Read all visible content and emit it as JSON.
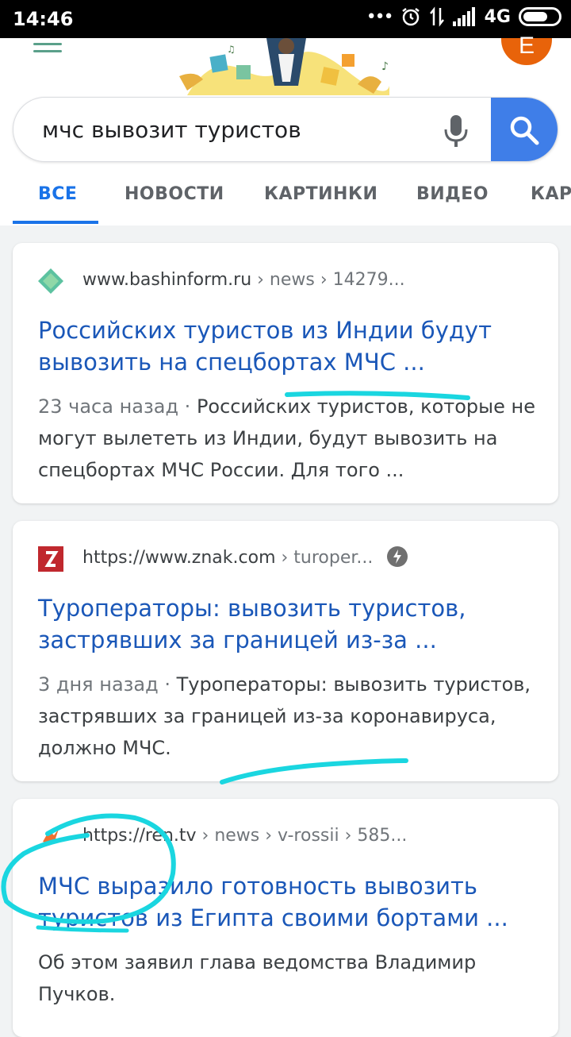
{
  "status_bar": {
    "time": "14:46",
    "network": "4G"
  },
  "header": {
    "avatar_letter": "E"
  },
  "search": {
    "query": "мчс вывозит туристов"
  },
  "tabs": [
    {
      "label": "ВСЕ",
      "active": true
    },
    {
      "label": "НОВОСТИ",
      "active": false
    },
    {
      "label": "КАРТИНКИ",
      "active": false
    },
    {
      "label": "ВИДЕО",
      "active": false
    },
    {
      "label": "КАР",
      "active": false
    }
  ],
  "results": [
    {
      "site": "www.bashinform.ru",
      "path": " › news › 14279...",
      "title": "Российских туристов из Индии будут вывозить на спецбортах МЧС ...",
      "date": "23 часа назад · ",
      "snippet": "Российских туристов, которые не могут вылететь из Индии, будут вывозить на спецбортах МЧС России. Для того ..."
    },
    {
      "site": "https://www.znak.com",
      "path": " › turoper...",
      "title": "Туроператоры: вывозить туристов, застрявших за границей из-за ...",
      "date": "3 дня назад · ",
      "snippet": "Туроператоры: вывозить туристов, застрявших за границей из-за коронавируса, должно МЧС."
    },
    {
      "site": "https://ren.tv",
      "path": " › news › v-rossii › 585...",
      "title": "МЧС выразило готовность вывозить туристов из Египта своими бортами ...",
      "date": "",
      "snippet": "Об этом заявил глава ведомства Владимир Пучков."
    }
  ],
  "colors": {
    "accent": "#1a73e8",
    "title_link": "#1a57b8",
    "search_button": "#3f7ee8",
    "annotation": "#1ad6e0",
    "avatar": "#e8630a"
  }
}
